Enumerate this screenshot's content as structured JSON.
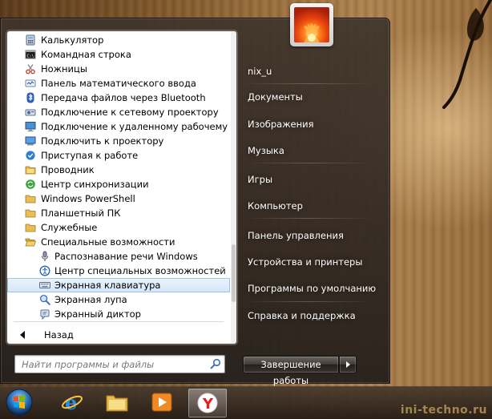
{
  "programs": [
    {
      "label": "Калькулятор",
      "icon": "calculator-icon",
      "sub": false
    },
    {
      "label": "Командная строка",
      "icon": "command-prompt-icon",
      "sub": false
    },
    {
      "label": "Ножницы",
      "icon": "scissors-icon",
      "sub": false
    },
    {
      "label": "Панель математического ввода",
      "icon": "math-input-icon",
      "sub": false
    },
    {
      "label": "Передача файлов через Bluetooth",
      "icon": "bluetooth-icon",
      "sub": false
    },
    {
      "label": "Подключение к сетевому проектору",
      "icon": "network-projector-icon",
      "sub": false
    },
    {
      "label": "Подключение к удаленному рабочему столу",
      "icon": "remote-desktop-icon",
      "sub": false
    },
    {
      "label": "Подключить к проектору",
      "icon": "projector-icon",
      "sub": false
    },
    {
      "label": "Приступая к работе",
      "icon": "getting-started-icon",
      "sub": false
    },
    {
      "label": "Проводник",
      "icon": "explorer-folder-icon",
      "sub": false
    },
    {
      "label": "Центр синхронизации",
      "icon": "sync-center-icon",
      "sub": false
    },
    {
      "label": "Windows PowerShell",
      "icon": "folder-icon",
      "sub": false
    },
    {
      "label": "Планшетный ПК",
      "icon": "folder-icon",
      "sub": false
    },
    {
      "label": "Служебные",
      "icon": "folder-icon",
      "sub": false
    },
    {
      "label": "Специальные возможности",
      "icon": "folder-open-icon",
      "sub": false
    },
    {
      "label": "Распознавание речи Windows",
      "icon": "microphone-icon",
      "sub": true
    },
    {
      "label": "Центр специальных возможностей",
      "icon": "ease-of-access-icon",
      "sub": true
    },
    {
      "label": "Экранная клавиатура",
      "icon": "keyboard-icon",
      "sub": true,
      "selected": true
    },
    {
      "label": "Экранная лупа",
      "icon": "magnifier-icon",
      "sub": true
    },
    {
      "label": "Экранный диктор",
      "icon": "narrator-icon",
      "sub": true
    }
  ],
  "back_label": "Назад",
  "search": {
    "placeholder": "Найти программы и файлы"
  },
  "right_items": [
    {
      "label": "nix_u",
      "name": "user-name-link"
    },
    {
      "label": "Документы",
      "name": "documents-link"
    },
    {
      "label": "Изображения",
      "name": "pictures-link"
    },
    {
      "label": "Музыка",
      "name": "music-link"
    },
    {
      "label": "Игры",
      "name": "games-link"
    },
    {
      "label": "Компьютер",
      "name": "computer-link"
    },
    {
      "label": "Панель управления",
      "name": "control-panel-link"
    },
    {
      "label": "Устройства и принтеры",
      "name": "devices-printers-link"
    },
    {
      "label": "Программы по умолчанию",
      "name": "default-programs-link"
    },
    {
      "label": "Справка и поддержка",
      "name": "help-support-link"
    }
  ],
  "shutdown_label": "Завершение работы",
  "taskbar_items": [
    "internet-explorer-icon",
    "file-explorer-icon",
    "media-player-icon",
    "yandex-browser-icon"
  ],
  "watermark": "ini-techno.ru",
  "colors": {
    "selected_bg": "#d4e6f8",
    "selected_border": "#9cc3e8",
    "menu_dark": "#3e342c"
  }
}
